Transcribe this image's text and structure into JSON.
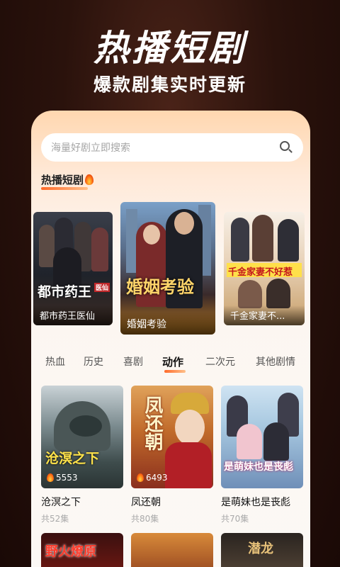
{
  "hero": {
    "title": "热播短剧",
    "subtitle": "爆款剧集实时更新"
  },
  "search": {
    "placeholder": "海量好剧立即搜索",
    "icon": "search-icon"
  },
  "hot_section": {
    "title": "热播短剧",
    "icon": "fire-icon",
    "items": [
      {
        "label": "都市药王医仙",
        "poster_text": "都市药王",
        "poster_tag": "医仙"
      },
      {
        "label": "婚姻考验",
        "poster_text": "婚姻考验"
      },
      {
        "label": "千金家妻不...",
        "poster_text": "千金家妻不好惹"
      }
    ]
  },
  "tabs": {
    "items": [
      "热血",
      "历史",
      "喜剧",
      "动作",
      "二次元",
      "其他剧情"
    ],
    "active": "动作"
  },
  "grid": [
    {
      "title": "沧溟之下",
      "episodes": "共52集",
      "views": "5553",
      "poster_text": "沧溟之下"
    },
    {
      "title": "凤还朝",
      "episodes": "共80集",
      "views": "6493",
      "poster_text": "凤还朝"
    },
    {
      "title": "是萌妹也是丧彪",
      "episodes": "共70集",
      "views": "",
      "poster_text": "是萌妹也是丧彪"
    }
  ],
  "bottom_posters": [
    {
      "poster_text": "野火燎原"
    },
    {
      "poster_text": ""
    },
    {
      "poster_text": "潜龙"
    }
  ],
  "colors": {
    "accent": "#ff6a2a",
    "background": "#2a120c"
  }
}
